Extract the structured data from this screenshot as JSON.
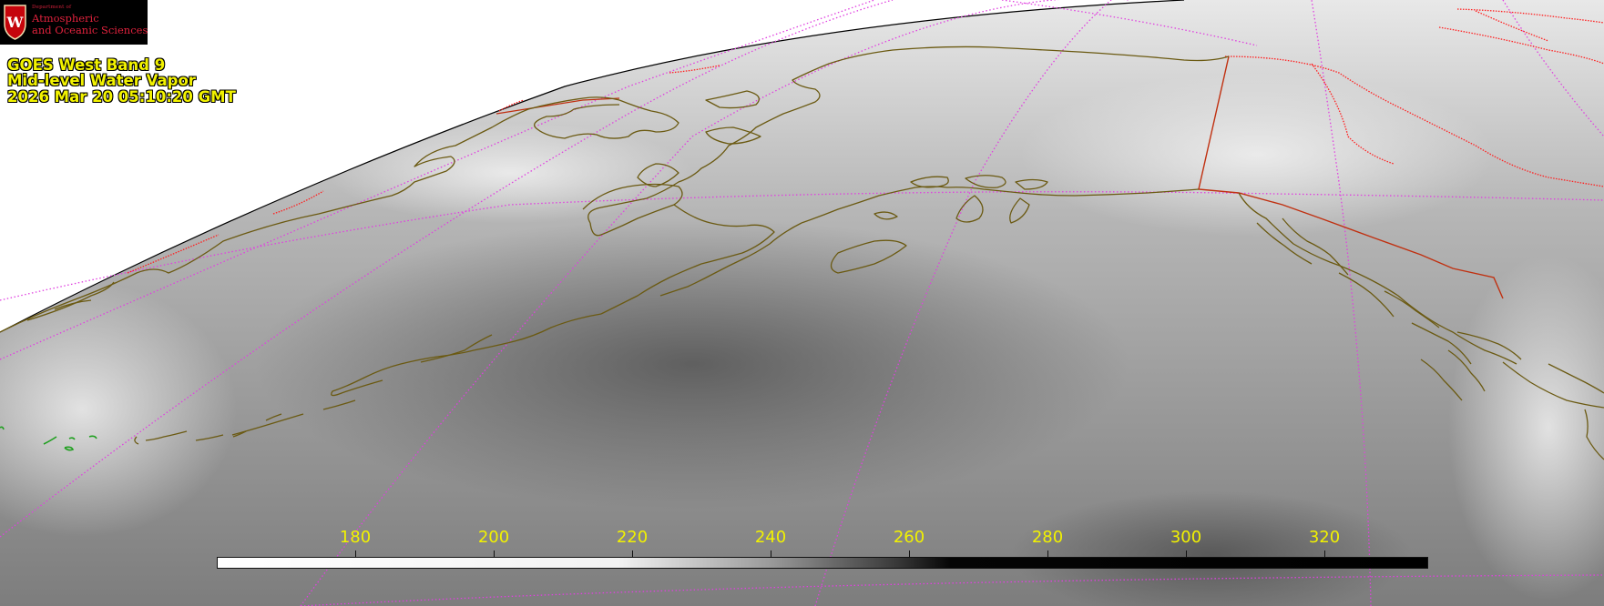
{
  "logo": {
    "department": "Department of",
    "line1": "Atmospheric",
    "line2": "and Oceanic Sciences",
    "crest_letter": "W",
    "crest_color": "#c5050c"
  },
  "caption": {
    "line1": "GOES West Band 9",
    "line2": "Mid-level Water Vapor",
    "line3": "2026 Mar 20  05:10:20 GMT"
  },
  "scale": {
    "min": 160,
    "max": 335,
    "ticks": [
      {
        "value": 180,
        "label": "180"
      },
      {
        "value": 200,
        "label": "200"
      },
      {
        "value": 220,
        "label": "220"
      },
      {
        "value": 240,
        "label": "240"
      },
      {
        "value": 260,
        "label": "260"
      },
      {
        "value": 280,
        "label": "280"
      },
      {
        "value": 300,
        "label": "300"
      },
      {
        "value": 320,
        "label": "320"
      }
    ],
    "gradient": [
      {
        "value": 160,
        "color": "#ffffff"
      },
      {
        "value": 218,
        "color": "#f2f2f2"
      },
      {
        "value": 240,
        "color": "#9a9a9a"
      },
      {
        "value": 258,
        "color": "#3a3a3a"
      },
      {
        "value": 266,
        "color": "#050505"
      },
      {
        "value": 335,
        "color": "#000000"
      }
    ]
  },
  "colors": {
    "text": "#f2f200",
    "coast": "#6b5a12",
    "border": "#ff2020",
    "grid": "#e040e0",
    "limb": "#000000",
    "space": "#ffffff"
  }
}
